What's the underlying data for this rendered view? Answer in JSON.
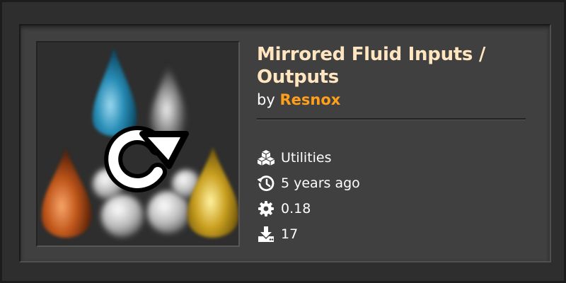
{
  "mod": {
    "title": "Mirrored Fluid Inputs / Outputs",
    "author_prefix": "by",
    "author": "Resnox"
  },
  "meta": {
    "category": {
      "icon": "cubes-icon",
      "label": "Utilities"
    },
    "updated": {
      "icon": "history-icon",
      "label": "5 years ago"
    },
    "version": {
      "icon": "gear-icon",
      "label": "0.18"
    },
    "downloads": {
      "icon": "download-icon",
      "label": "17"
    }
  },
  "colors": {
    "title": "#ffe6c0",
    "author": "#ff9f1c",
    "card_bg": "#404040"
  }
}
